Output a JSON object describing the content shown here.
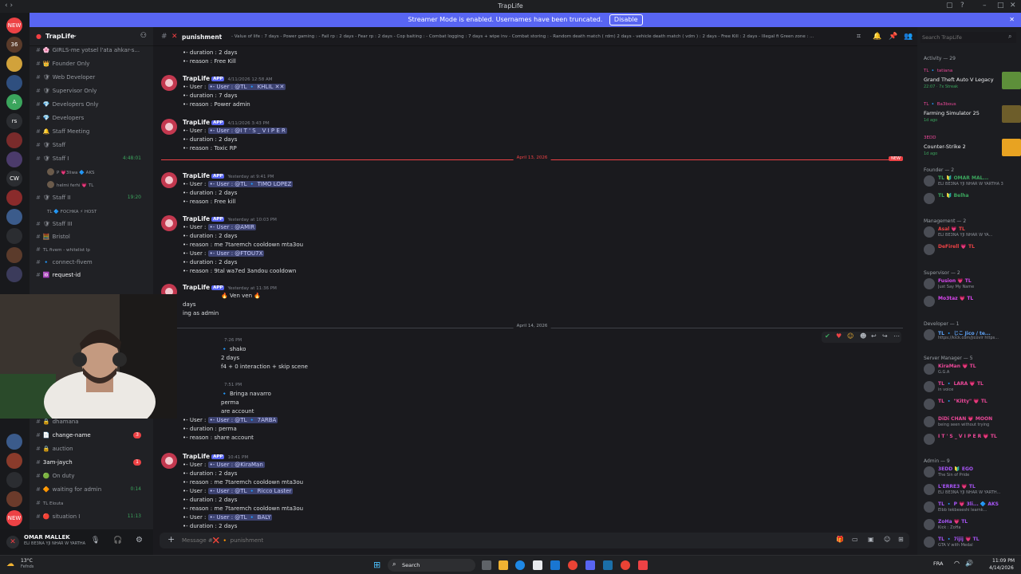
{
  "window": {
    "title": "TrapLife"
  },
  "banner": {
    "text": "Streamer Mode is enabled. Usernames have been truncated.",
    "button": "Disable"
  },
  "server": {
    "name": "TrapLife"
  },
  "guilds": [
    {
      "label": "NEW",
      "color": "#ed4245"
    },
    {
      "label": "36",
      "color": "#5a3b2a"
    },
    {
      "label": "",
      "color": "#d1a23b"
    },
    {
      "label": "",
      "color": "#2f4f7f"
    },
    {
      "label": "A",
      "color": "#3ba55d"
    },
    {
      "label": "rs",
      "color": "#2b2d31"
    },
    {
      "label": "",
      "color": "#7a2b2b"
    },
    {
      "label": "",
      "color": "#4b3b6b"
    },
    {
      "label": "CW",
      "color": "#2b2d31"
    },
    {
      "label": "",
      "color": "#8a2b2b"
    },
    {
      "label": "",
      "color": "#3b5b8b"
    },
    {
      "label": "",
      "color": "#2b2d31"
    },
    {
      "label": "",
      "color": "#5b3b2b"
    },
    {
      "label": "",
      "color": "#3b3b5b"
    }
  ],
  "guilds_bottom": [
    {
      "label": "",
      "color": "#3b5b8b"
    },
    {
      "label": "",
      "color": "#8a3b2b"
    },
    {
      "label": "",
      "color": "#2b2d31"
    },
    {
      "label": "",
      "color": "#6b3b2b"
    },
    {
      "label": "NEW",
      "color": "#ed4245"
    }
  ],
  "channels": [
    {
      "label": "GIRLS-me yotsel l'ata ahkar-s...",
      "em": "🌸",
      "color": "#94989f"
    },
    {
      "label": "Founder Only",
      "em": "👑",
      "color": "#94989f"
    },
    {
      "label": "Web Developer",
      "em": "🛡",
      "color": "#94989f"
    },
    {
      "label": "Supervisor Only",
      "em": "🛡",
      "color": "#94989f"
    },
    {
      "label": "Developers Only",
      "em": "💎",
      "color": "#94989f"
    },
    {
      "label": "Developers",
      "em": "💎",
      "color": "#94989f"
    },
    {
      "label": "Staff Meeting",
      "em": "🔔",
      "color": "#94989f"
    },
    {
      "label": "Staff",
      "em": "🛡",
      "color": "#94989f"
    },
    {
      "label": "Staff I",
      "em": "🛡",
      "color": "#94989f",
      "right": "4:48:01",
      "rightColor": "#3ba55d"
    }
  ],
  "voice_users": [
    {
      "label": "P 💗3liwa 🔷 AKS"
    },
    {
      "label": "helmi ferhi 💗 TL"
    }
  ],
  "channels2": [
    {
      "label": "Staff II",
      "em": "🛡",
      "color": "#94989f",
      "right": "19:20",
      "rightColor": "#3ba55d"
    }
  ],
  "voice_users2": [
    {
      "label": "TL 🔷 FOCHKA ⚡ HOST"
    }
  ],
  "channels3": [
    {
      "label": "Staff III",
      "em": "🛡",
      "color": "#94989f"
    },
    {
      "label": "Bristol",
      "em": "🧮",
      "color": "#94989f"
    },
    {
      "label": "TL fivem - whitelist lp",
      "em": "",
      "color": "#94989f",
      "small": true
    },
    {
      "label": "connect-fivem",
      "em": "🔹",
      "color": "#94989f"
    },
    {
      "label": "request-id",
      "em": "🆔",
      "color": "#f2f3f5"
    }
  ],
  "channels_bottom": [
    {
      "label": "dhamana",
      "em": "🔒",
      "color": "#94989f"
    },
    {
      "label": "change-name",
      "em": "📄",
      "color": "#f2f3f5",
      "badge": "3"
    },
    {
      "label": "auction",
      "em": "🔒",
      "color": "#94989f"
    },
    {
      "label": "3am-jaych",
      "em": "",
      "color": "#f2f3f5",
      "badge": "1"
    },
    {
      "label": "On duty",
      "em": "🟢",
      "color": "#94989f"
    },
    {
      "label": "waiting for admin",
      "em": "🔶",
      "color": "#94989f",
      "right": "0:14",
      "rightColor": "#3ba55d"
    },
    {
      "label": "TL Elouta",
      "em": "",
      "color": "#94989f",
      "small": true
    },
    {
      "label": "situation I",
      "em": "🔴",
      "color": "#94989f",
      "right": "11:13",
      "rightColor": "#3ba55d"
    }
  ],
  "user": {
    "name": "OMAR MALLEK",
    "status": "ELI BE3NA YJI NHAR W YARTHA"
  },
  "chat_header": {
    "channel": "punishment",
    "topic": "- Value of life : 7 days - Power gaming : - Fail rp : 2 days - Fear rp : 2 days - Cop baiting : - Combat logging : 7 days + wipe inv - Combat storing : - Random death match ( rdm) 2 days - vehicle death match ( vdm ) : 2 days - Free Kill : 2 days - Illegal fi Green zone : ...",
    "search": "Search TrapLife"
  },
  "messages": [
    {
      "author": "",
      "time": "",
      "lines": [
        "•- duration : 2 days",
        "•- reason : Free Kill"
      ]
    },
    {
      "author": "TrapLife",
      "time": "4/11/2026 12:58 AM",
      "lines": [
        "•- User : @TL 🔹 KHLIL ✕✕",
        "•- duration : 7 days",
        "•- reason : Power admin"
      ]
    },
    {
      "author": "TrapLife",
      "time": "4/11/2026 3:43 PM",
      "lines": [
        "•- User : @I T ' S _ V I P E R",
        "•- duration : 2 days",
        "•- reason : Toxic RP"
      ]
    },
    {
      "author": "TrapLife",
      "time": "Yesterday at 9:41 PM",
      "lines": [
        "•- User : @TL 🔹 TIMO LOPEZ",
        "•- duration : 2 days",
        "•- reason : Free kill"
      ]
    },
    {
      "author": "TrapLife",
      "time": "Yesterday at 10:03 PM",
      "lines": [
        "•- User : @AMIR",
        "•- duration : 2 days",
        "•- reason : me 7taremch cooldown mta3ou",
        "•- User : @FTOU7X",
        "•- duration : 2 days",
        "•- reason : 9tal wa7ed 3andou  cooldown"
      ]
    },
    {
      "author": "TrapLife",
      "time": "Yesterday at 11:36 PM",
      "lines": [
        "🔥 Ven ven 🔥",
        "days",
        "ing as admin"
      ]
    },
    {
      "author": "",
      "time": "7:26 PM",
      "lines": [
        "🔹 shako",
        "2 days",
        "f4 + 0 interaction  + skip scene"
      ]
    },
    {
      "author": "",
      "time": "7:51 PM",
      "lines": [
        "🔹 Bringa navarro",
        "perma",
        "are account",
        "•- User : @TL 🔹 7ARBA",
        "•- duration : perma",
        "•- reason : share account"
      ]
    },
    {
      "author": "TrapLife",
      "time": "10:41 PM",
      "lines": [
        "•- User : @KiraMan",
        "•- duration : 2 days",
        "•- reason : me 7taremch cooldown mta3ou",
        "•- User : @TL 🔹 Ricco Laster",
        "•- duration : 2 days",
        "•- reason : me 7taremch cooldown mta3ou",
        "•- User : @TL 🔹 BALY",
        "•- duration : 2 days"
      ]
    }
  ],
  "dividers": [
    {
      "label": "April 13, 2026",
      "color": "#ed4245",
      "new": "NEW"
    },
    {
      "label": "April 14, 2026",
      "color": "#3f4147"
    }
  ],
  "composer": {
    "placeholder": "Message #❌ 🔸 punishment"
  },
  "members": {
    "activity": "Activity — 29",
    "activities": [
      {
        "user": "TL 🔹 tatiana",
        "game": "Grand Theft Auto V Legacy",
        "meta": "22:07 · 7x Streak"
      },
      {
        "user": "TL 🔹 Ba3bous",
        "game": "Farming Simulator 25",
        "meta": "1d ago"
      },
      {
        "user": "3EDD",
        "game": "Counter-Strike 2",
        "meta": "1d ago"
      }
    ],
    "groups": [
      {
        "title": "Founder — 2",
        "items": [
          {
            "name": "TL 🔰 OMAR MAL...",
            "color": "#3ba55d",
            "sub": "ELI BE3NA YJI NHAR W YARTHA 3"
          },
          {
            "name": "TL 🔰 Belha",
            "color": "#3ba55d",
            "sub": ""
          }
        ]
      },
      {
        "title": "Management — 2",
        "items": [
          {
            "name": "Asal 💗 TL",
            "color": "#ed4245",
            "sub": "ELI BE3NA YJI NHAR W YA..."
          },
          {
            "name": "DeFirell 💗 TL",
            "color": "#ed4245",
            "sub": ""
          }
        ]
      },
      {
        "title": "Supervisor — 2",
        "items": [
          {
            "name": "Fusion 💗 TL",
            "color": "#d946ef",
            "sub": "Just Say My Name"
          },
          {
            "name": "Mo3taz 💗 TL",
            "color": "#d946ef",
            "sub": ""
          }
        ]
      },
      {
        "title": "Developer — 1",
        "items": [
          {
            "name": "TL 🔹 じこ Jico / te...",
            "color": "#60a5fa",
            "sub": "https://kick.com/jicovlr https..."
          }
        ]
      },
      {
        "title": "Server Manager — 5",
        "items": [
          {
            "name": "KiraMan 💗 TL",
            "color": "#ec4899",
            "sub": "G.G.A"
          },
          {
            "name": "TL 🔹 LARA 💗 TL",
            "color": "#ec4899",
            "sub": "in voice"
          },
          {
            "name": "TL 🔹 \"Kitty\" 💗 TL",
            "color": "#ec4899",
            "sub": ""
          },
          {
            "name": "DiDi CHAN 💗 MOON",
            "color": "#ec4899",
            "sub": "being seen without trying"
          },
          {
            "name": "I T ' S _ V I P E R 💗 TL",
            "color": "#ec4899",
            "sub": ""
          }
        ]
      },
      {
        "title": "Admin — 9",
        "items": [
          {
            "name": "3EDD 🔰 EGO",
            "color": "#a855f7",
            "sub": "The Sin of Pride"
          },
          {
            "name": "L'ERRE3 💗 TL",
            "color": "#a855f7",
            "sub": "ELI BE3NA YJI NHAR W YARTH..."
          },
          {
            "name": "TL 🔹 P 💗 3li... 🔷 AKS",
            "color": "#a855f7",
            "sub": "Elbb tekbeseshi learnk..."
          },
          {
            "name": "ZoHa 💗 TL",
            "color": "#a855f7",
            "sub": "Kick : ZoHa"
          },
          {
            "name": "TL 🔹 7ijij 💗 TL",
            "color": "#a855f7",
            "sub": "GTA V with Medal"
          }
        ]
      }
    ]
  },
  "taskbar": {
    "weather": "13°C",
    "weather_sub": "Fefnds",
    "search": "Search",
    "lang": "FRA",
    "time": "11:09 PM",
    "date": "4/14/2026"
  }
}
